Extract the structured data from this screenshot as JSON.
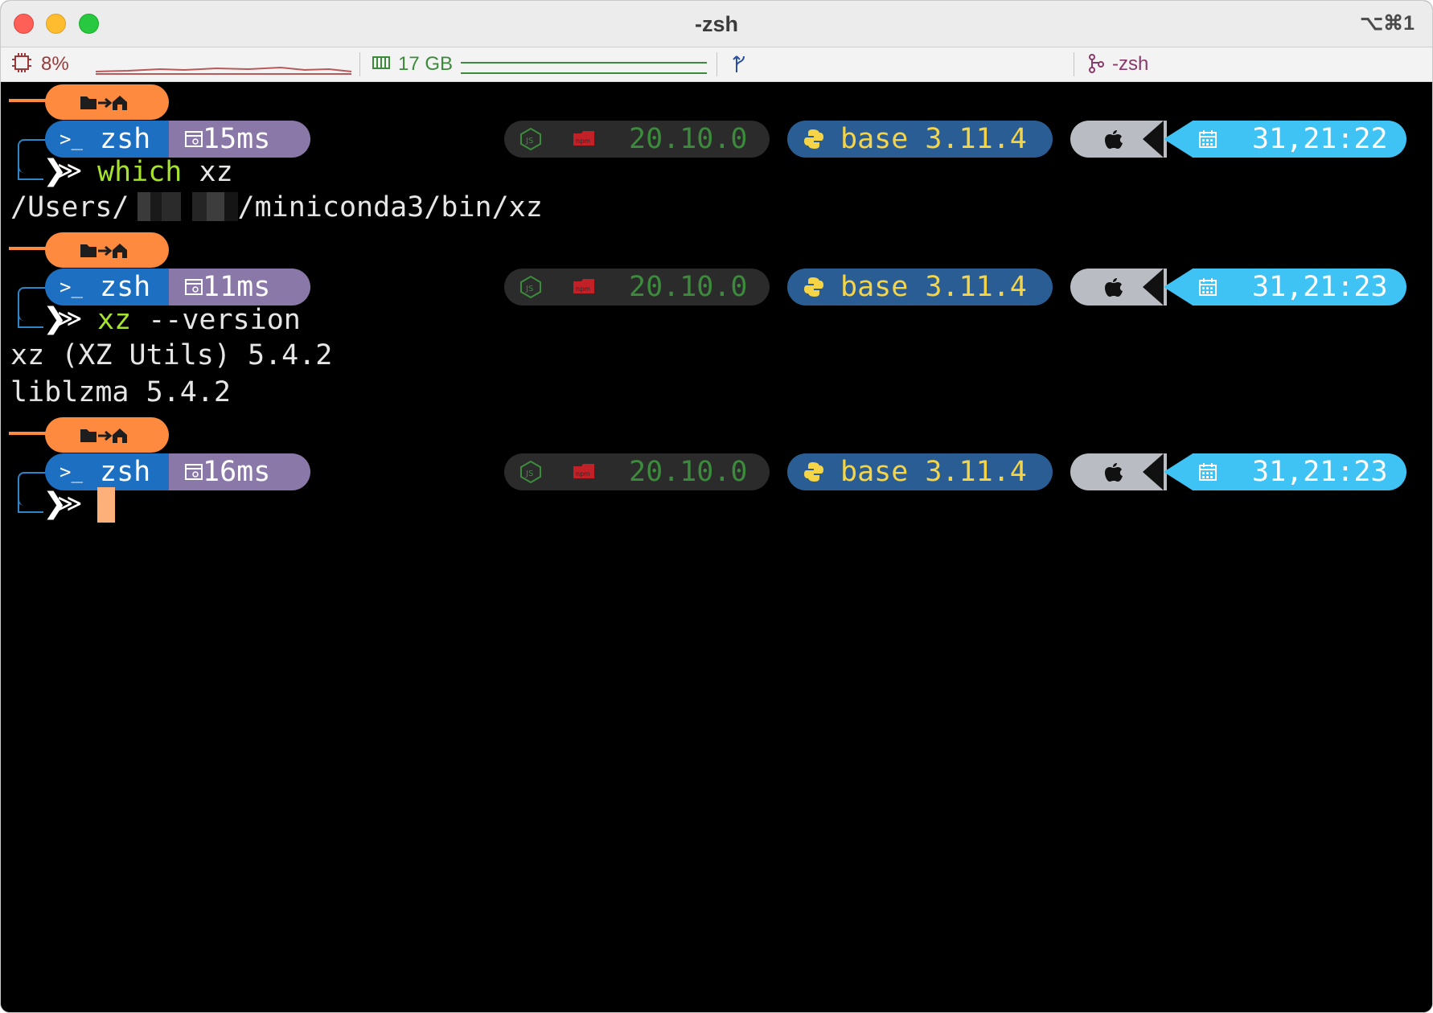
{
  "window": {
    "title": "-zsh",
    "shortcut": "⌥⌘1"
  },
  "statusbar": {
    "cpu": "8%",
    "memory": "17 GB",
    "session": "-zsh",
    "colors": {
      "cpu": "#9a3a3a",
      "memory": "#3c8a3c",
      "git": "#2a4fa0",
      "session": "#8a3a6a"
    }
  },
  "prompts": [
    {
      "dir_icons": "folder-arrow-home",
      "shell": "zsh",
      "duration": "15ms",
      "node_version": "20.10.0",
      "python_env": "base 3.11.4",
      "time": "31,21:22",
      "command": "which",
      "args": "xz",
      "output": [
        "/Users/",
        "/miniconda3/bin/xz"
      ]
    },
    {
      "dir_icons": "folder-arrow-home",
      "shell": "zsh",
      "duration": "11ms",
      "node_version": "20.10.0",
      "python_env": "base 3.11.4",
      "time": "31,21:23",
      "command": "xz",
      "args": "--version",
      "output": [
        "xz (XZ Utils) 5.4.2",
        "liblzma 5.4.2"
      ]
    },
    {
      "dir_icons": "folder-arrow-home",
      "shell": "zsh",
      "duration": "16ms",
      "node_version": "20.10.0",
      "python_env": "base 3.11.4",
      "time": "31,21:23",
      "command": "",
      "args": "",
      "output": []
    }
  ],
  "theme": {
    "dir_pill": "#fd8a3e",
    "shell_pill": "#1d6fc1",
    "duration_pill": "#8a79a8",
    "node_pill": "#2b2b2b",
    "node_text": "#3c8a3c",
    "python_pill": "#2a5d93",
    "python_text": "#f5d547",
    "os_pill": "#b9bcc2",
    "time_pill": "#3fc3f5",
    "command_color": "#a6e22e",
    "cursor": "#fdb07a"
  }
}
